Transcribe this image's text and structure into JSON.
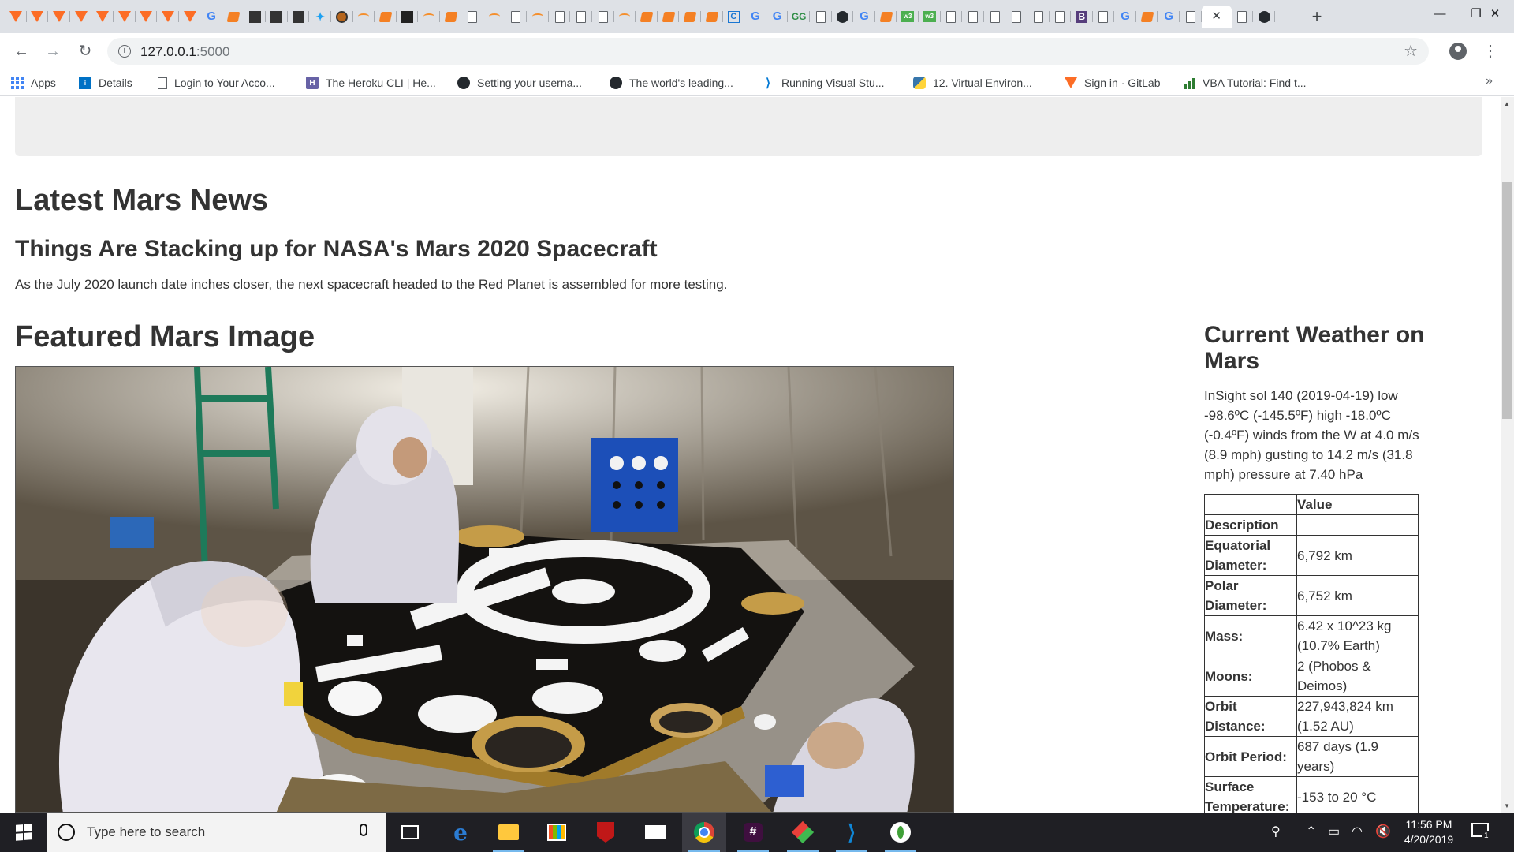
{
  "browser": {
    "tab_favicons": [
      "gitlab-icon",
      "gitlab-icon",
      "gitlab-icon",
      "gitlab-icon",
      "gitlab-icon",
      "gitlab-icon",
      "gitlab-icon",
      "gitlab-icon",
      "gitlab-icon",
      "google-icon",
      "stackoverflow-icon",
      "xbox-icon",
      "xbox-icon",
      "xbox-icon",
      "twitter-icon",
      "mars-icon",
      "heroku-icon",
      "stackoverflow-icon",
      "dots-icon",
      "heroku-icon",
      "stackoverflow-icon",
      "document-icon",
      "heroku-icon",
      "document-icon",
      "heroku-icon",
      "document-icon",
      "document-icon",
      "document-icon",
      "heroku-icon",
      "stackoverflow-icon",
      "stackoverflow-icon",
      "stackoverflow-icon",
      "stackoverflow-icon",
      "codecademy-icon",
      "google-icon",
      "google-icon",
      "geeksforgeeks-icon",
      "document-icon",
      "github-icon",
      "google-icon",
      "stackoverflow-icon",
      "w3schools-icon",
      "w3schools-icon",
      "document-icon",
      "document-icon",
      "document-icon",
      "document-icon",
      "document-icon",
      "document-icon",
      "bootstrap-icon",
      "document-icon",
      "google-icon",
      "stackoverflow-icon",
      "google-icon",
      "document-icon"
    ],
    "active_tab_icon": "close-icon",
    "after_active_favicons": [
      "document-icon",
      "github-icon"
    ],
    "new_tab_glyph": "+",
    "window_controls": {
      "minimize": "—",
      "maximize": "❐",
      "close": "✕"
    },
    "nav": {
      "back": "←",
      "forward": "→",
      "reload": "↻"
    },
    "url_host": "127.0.0.1",
    "url_port": ":5000",
    "info_glyph": "i",
    "star_glyph": "☆",
    "menu_glyph": "⋮",
    "bookmarks": [
      {
        "icon": "apps-icon",
        "label": "Apps"
      },
      {
        "icon": "intel-icon",
        "label": "Details"
      },
      {
        "icon": "document-icon",
        "label": "Login to Your Acco..."
      },
      {
        "icon": "heroku-icon",
        "label": "The Heroku CLI | He..."
      },
      {
        "icon": "github-icon",
        "label": "Setting your userna..."
      },
      {
        "icon": "github-icon",
        "label": "The world's leading..."
      },
      {
        "icon": "vscode-icon",
        "label": "Running Visual Stu..."
      },
      {
        "icon": "python-icon",
        "label": "12. Virtual Environ..."
      },
      {
        "icon": "gitlab-icon",
        "label": "Sign in · GitLab"
      },
      {
        "icon": "bar-chart-icon",
        "label": "VBA Tutorial: Find t..."
      }
    ],
    "bookmarks_more": "»"
  },
  "page": {
    "news_heading": "Latest Mars News",
    "news_title": "Things Are Stacking up for NASA's Mars 2020 Spacecraft",
    "news_paragraph": "As the July 2020 launch date inches closer, the next spacecraft headed to the Red Planet is assembled for more testing.",
    "image_heading": "Featured Mars Image",
    "weather_heading": "Current Weather on Mars",
    "weather_text": "InSight sol 140 (2019-04-19) low -98.6ºC (-145.5ºF) high -18.0ºC (-0.4ºF) winds from the W at 4.0 m/s (8.9 mph) gusting to 14.2 m/s (31.8 mph) pressure at 7.40 hPa",
    "facts": {
      "header": [
        "",
        "Value"
      ],
      "rows": [
        {
          "label": "Description",
          "value": ""
        },
        {
          "label": "Equatorial Diameter:",
          "value": "6,792 km"
        },
        {
          "label": "Polar Diameter:",
          "value": "6,752 km"
        },
        {
          "label": "Mass:",
          "value": "6.42 x 10^23 kg (10.7% Earth)"
        },
        {
          "label": "Moons:",
          "value": "2 (Phobos & Deimos)"
        },
        {
          "label": "Orbit Distance:",
          "value": "227,943,824 km (1.52 AU)"
        },
        {
          "label": "Orbit Period:",
          "value": "687 days (1.9 years)"
        },
        {
          "label": "Surface Temperature:",
          "value": "-153 to 20 °C"
        }
      ]
    }
  },
  "taskbar": {
    "search_placeholder": "Type here to search",
    "apps": [
      "task-view-icon",
      "edge-icon",
      "file-explorer-icon",
      "store-icon",
      "mcafee-icon",
      "mail-icon",
      "chrome-icon",
      "slack-icon",
      "git-icon",
      "vscode-icon",
      "mongodb-icon"
    ],
    "tray_icons": [
      "people-icon",
      "chevron-up-icon",
      "battery-icon",
      "wifi-icon",
      "volume-muted-icon"
    ],
    "time": "11:56 PM",
    "date": "4/20/2019",
    "notification_count": "1"
  }
}
